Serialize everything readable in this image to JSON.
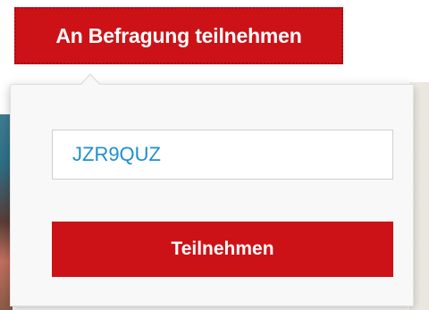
{
  "header": {
    "join_survey_label": "An Befragung teilnehmen"
  },
  "popover": {
    "code_value": "JZR9QUZ",
    "submit_label": "Teilnehmen"
  },
  "colors": {
    "brand_red": "#cc1217",
    "input_text": "#1f8fcf"
  }
}
